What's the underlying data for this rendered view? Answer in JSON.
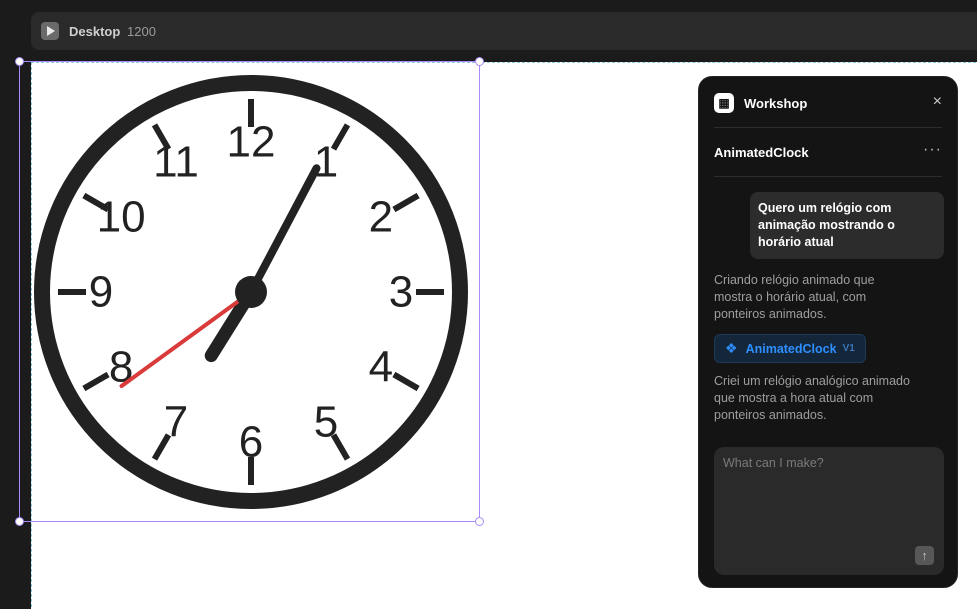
{
  "toolbar": {
    "frame_name": "Desktop",
    "frame_width": "1200",
    "play_icon": "play-icon"
  },
  "clock": {
    "numbers": [
      "12",
      "1",
      "2",
      "3",
      "4",
      "5",
      "6",
      "7",
      "8",
      "9",
      "10",
      "11"
    ],
    "time": {
      "hour": 7,
      "minute": 4,
      "second": 39
    },
    "colors": {
      "face": "#ffffff",
      "rim": "#222222",
      "hands": "#222222",
      "second_hand": "#d93a3a"
    }
  },
  "panel": {
    "logo_icon": "workshop-logo-icon",
    "title": "Workshop",
    "close_label": "×",
    "component_name": "AnimatedClock",
    "more_label": "···",
    "messages": {
      "user": "Quero um relógio com animação mostrando o horário atual",
      "ai_intro": "Criando relógio animado que mostra o horário atual, com ponteiros animados.",
      "ai_done": "Criei um relógio analógico animado que mostra a hora atual com ponteiros animados."
    },
    "artifact": {
      "icon": "component-icon",
      "name": "AnimatedClock",
      "version": "V1",
      "color": "#2e8fff"
    },
    "input": {
      "placeholder": "What can I make?",
      "value": ""
    },
    "send_icon": "arrow-up-icon"
  }
}
